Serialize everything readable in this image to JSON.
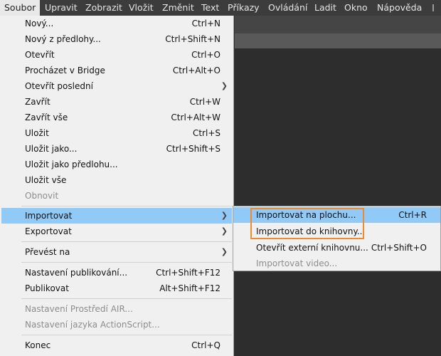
{
  "menubar": {
    "items": [
      "Soubor",
      "Upravit",
      "Zobrazit",
      "Vložit",
      "Změnit",
      "Text",
      "Příkazy",
      "Ovládání",
      "Ladit",
      "Okno",
      "Nápověda"
    ]
  },
  "file_menu": {
    "items": [
      {
        "label": "Nový...",
        "shortcut": "Ctrl+N"
      },
      {
        "label": "Nový z předlohy...",
        "shortcut": "Ctrl+Shift+N"
      },
      {
        "label": "Otevřít",
        "shortcut": "Ctrl+O"
      },
      {
        "label": "Procházet v Bridge",
        "shortcut": "Ctrl+Alt+O"
      },
      {
        "label": "Otevřít poslední",
        "shortcut": ""
      },
      {
        "label": "Zavřít",
        "shortcut": "Ctrl+W"
      },
      {
        "label": "Zavřít vše",
        "shortcut": "Ctrl+Alt+W"
      },
      {
        "label": "Uložit",
        "shortcut": "Ctrl+S"
      },
      {
        "label": "Uložit jako...",
        "shortcut": "Ctrl+Shift+S"
      },
      {
        "label": "Uložit jako předlohu...",
        "shortcut": ""
      },
      {
        "label": "Uložit vše",
        "shortcut": ""
      },
      {
        "label": "Obnovit",
        "shortcut": ""
      },
      {
        "label": "Importovat",
        "shortcut": ""
      },
      {
        "label": "Exportovat",
        "shortcut": ""
      },
      {
        "label": "Převést na",
        "shortcut": ""
      },
      {
        "label": "Nastavení publikování...",
        "shortcut": "Ctrl+Shift+F12"
      },
      {
        "label": "Publikovat",
        "shortcut": "Alt+Shift+F12"
      },
      {
        "label": "Nastavení Prostředí AIR...",
        "shortcut": ""
      },
      {
        "label": "Nastavení jazyka ActionScript...",
        "shortcut": ""
      },
      {
        "label": "Konec",
        "shortcut": "Ctrl+Q"
      }
    ]
  },
  "import_submenu": {
    "items": [
      {
        "label": "Importovat na plochu...",
        "shortcut": "Ctrl+R"
      },
      {
        "label": "Importovat do knihovny...",
        "shortcut": ""
      },
      {
        "label": "Otevřít externí knihovnu...",
        "shortcut": "Ctrl+Shift+O"
      },
      {
        "label": "Importovat video...",
        "shortcut": ""
      }
    ]
  },
  "icons": {
    "submenu_arrow": "chevron-right-icon"
  },
  "colors": {
    "highlight": "#91c9f7",
    "annotation": "#f08a2c",
    "menubar": "#3c3c3c"
  }
}
